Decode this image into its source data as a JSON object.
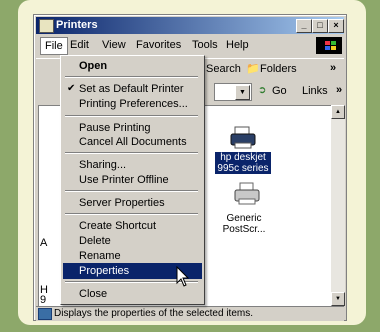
{
  "window": {
    "title": "Printers"
  },
  "menubar": [
    "File",
    "Edit",
    "View",
    "Favorites",
    "Tools",
    "Help"
  ],
  "toolbar": {
    "search": "Search",
    "folders": "Folders"
  },
  "address": {
    "go": "Go",
    "links": "Links"
  },
  "file_menu": {
    "open": "Open",
    "set_default": "Set as Default Printer",
    "printing_prefs": "Printing Preferences...",
    "pause": "Pause Printing",
    "cancel_all": "Cancel All Documents",
    "sharing": "Sharing...",
    "offline": "Use Printer Offline",
    "server_props": "Server Properties",
    "create_shortcut": "Create Shortcut",
    "delete": "Delete",
    "rename": "Rename",
    "properties": "Properties",
    "close": "Close"
  },
  "printers": [
    {
      "line1": "hp deskjet",
      "line2": "995c series"
    },
    {
      "line1": "Generic",
      "line2": "PostScr..."
    }
  ],
  "side_letters": [
    "A",
    "H",
    "9"
  ],
  "status_text": "Displays the properties of the selected items."
}
